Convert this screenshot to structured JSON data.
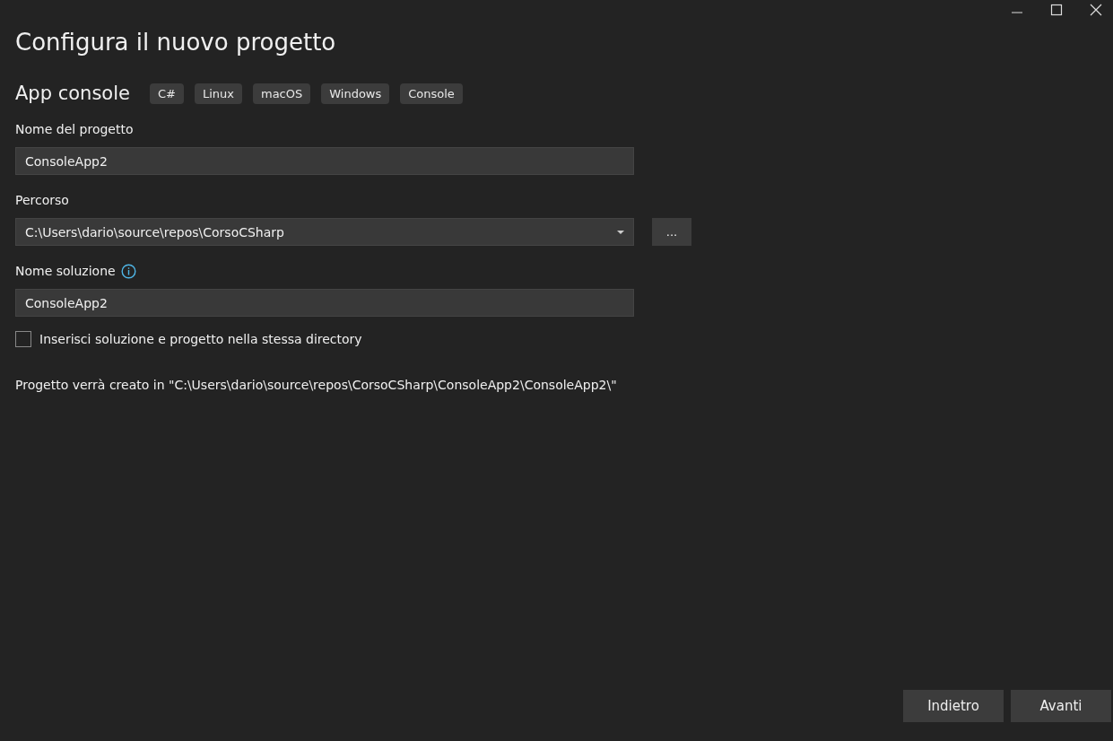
{
  "window": {
    "title": "Configura il nuovo progetto"
  },
  "template": {
    "name": "App console",
    "tags": [
      "C#",
      "Linux",
      "macOS",
      "Windows",
      "Console"
    ]
  },
  "fields": [
    {
      "kind": "text",
      "label": "Nome del progetto",
      "value": "ConsoleApp2",
      "info": false
    },
    {
      "kind": "dropdown",
      "label": "Percorso",
      "value": "C:\\Users\\dario\\source\\repos\\CorsoCSharp",
      "browse": "...",
      "info": false
    },
    {
      "kind": "text",
      "label": "Nome soluzione",
      "value": "ConsoleApp2",
      "info": true
    }
  ],
  "same_directory": {
    "label": "Inserisci soluzione e progetto nella stessa directory",
    "checked": false
  },
  "output_path": "Progetto verrà creato in \"C:\\Users\\dario\\source\\repos\\CorsoCSharp\\ConsoleApp2\\ConsoleApp2\\\"",
  "buttons": [
    "Indietro",
    "Avanti"
  ]
}
